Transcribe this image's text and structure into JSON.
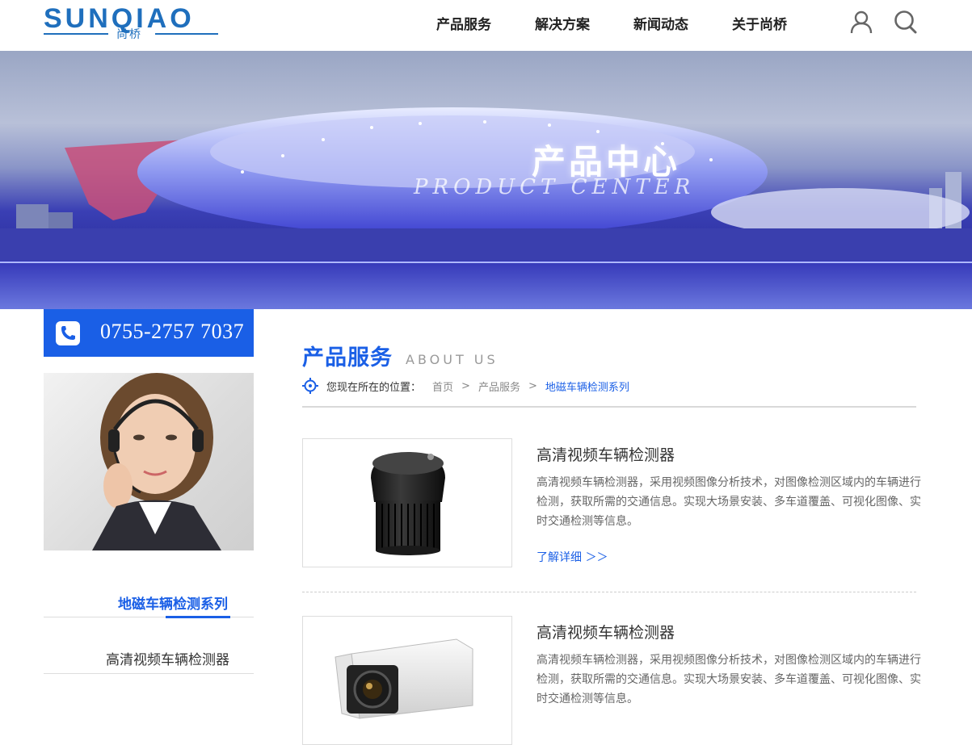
{
  "header": {
    "logo_text": "SUNQIAO",
    "logo_sub": "尚桥",
    "nav": [
      "产品服务",
      "解决方案",
      "新闻动态",
      "关于尚桥"
    ],
    "icons": {
      "user": "user-icon",
      "search": "search-icon"
    }
  },
  "banner": {
    "title": "产品中心",
    "subtitle": "PRODUCT CENTER"
  },
  "sidebar": {
    "phone": "0755-2757 7037",
    "category_title": "地磁车辆检测系列",
    "items": [
      {
        "label": "高清视频车辆检测器"
      }
    ]
  },
  "main": {
    "section_title": "产品服务",
    "section_subtitle": "ABOUT US",
    "breadcrumb": {
      "prefix": "您现在所在的位置：",
      "items": [
        "首页",
        "产品服务"
      ],
      "separator": ">",
      "current": "地磁车辆检测系列"
    },
    "products": [
      {
        "title": "高清视频车辆检测器",
        "description": "高清视频车辆检测器，采用视频图像分析技术，对图像检测区域内的车辆进行检测，获取所需的交通信息。实现大场景安装、多车道覆盖、可视化图像、实时交通检测等信息。",
        "more": "了解详细 ＞＞"
      },
      {
        "title": "高清视频车辆检测器",
        "description": "高清视频车辆检测器，采用视频图像分析技术，对图像检测区域内的车辆进行检测，获取所需的交通信息。实现大场景安装、多车道覆盖、可视化图像、实时交通检测等信息。"
      }
    ]
  },
  "colors": {
    "brand_blue": "#1a5fe6",
    "logo_blue": "#1f6fbd"
  }
}
